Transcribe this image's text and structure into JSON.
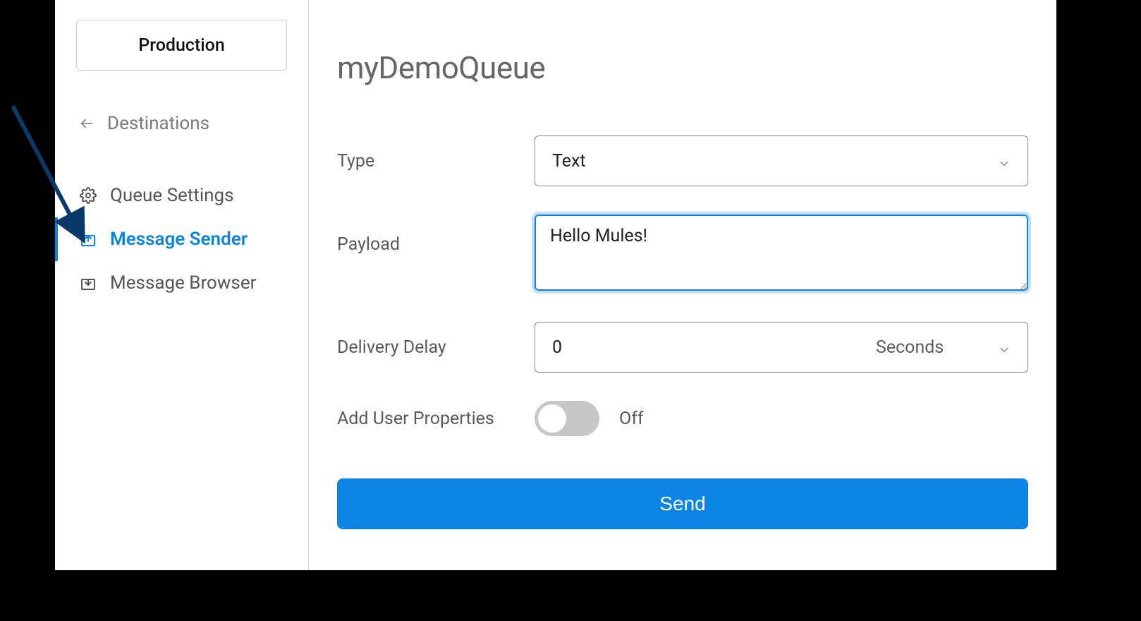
{
  "sidebar": {
    "env_label": "Production",
    "back_label": "Destinations",
    "items": [
      {
        "label": "Queue Settings"
      },
      {
        "label": "Message Sender"
      },
      {
        "label": "Message Browser"
      }
    ]
  },
  "main": {
    "title": "myDemoQueue",
    "type_label": "Type",
    "type_value": "Text",
    "payload_label": "Payload",
    "payload_value": "Hello Mules!",
    "delay_label": "Delivery Delay",
    "delay_value": "0",
    "delay_unit": "Seconds",
    "userprops_label": "Add User Properties",
    "userprops_state": "Off",
    "send_label": "Send"
  }
}
